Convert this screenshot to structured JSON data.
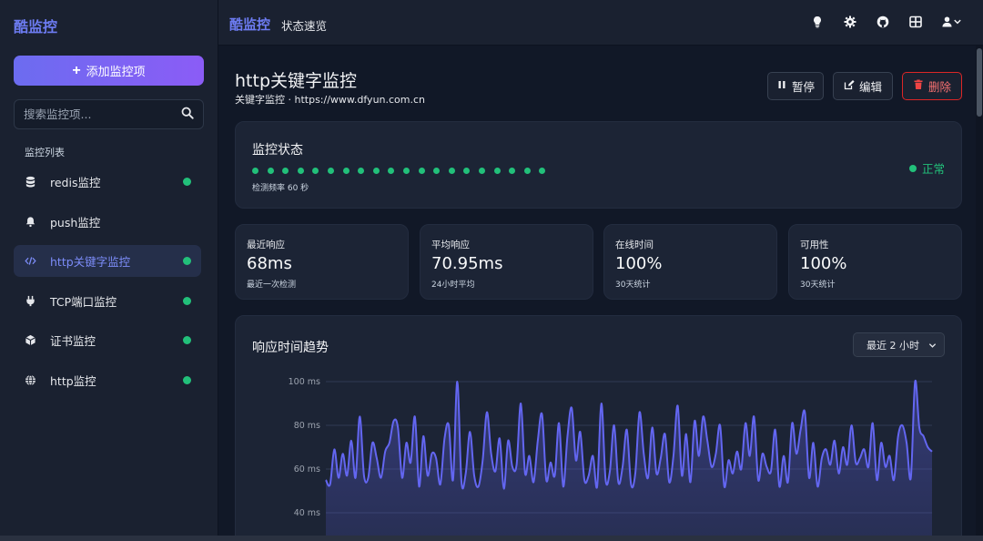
{
  "sidebar": {
    "brand": "酷监控",
    "add_button": "添加监控项",
    "search_placeholder": "搜索监控项...",
    "list_title": "监控列表",
    "items": [
      {
        "label": "redis监控",
        "icon": "database-icon",
        "status": "up"
      },
      {
        "label": "push监控",
        "icon": "bell-icon",
        "status": "none"
      },
      {
        "label": "http关键字监控",
        "icon": "code-icon",
        "status": "up",
        "active": true
      },
      {
        "label": "TCP端口监控",
        "icon": "plug-icon",
        "status": "up"
      },
      {
        "label": "证书监控",
        "icon": "cube-icon",
        "status": "up"
      },
      {
        "label": "http监控",
        "icon": "globe-icon",
        "status": "up"
      }
    ]
  },
  "topbar": {
    "brand": "酷监控",
    "subtitle": "状态速览",
    "icons": [
      "lightbulb-icon",
      "gear-icon",
      "github-icon",
      "grid-icon",
      "user-icon"
    ]
  },
  "monitor": {
    "title": "http关键字监控",
    "subtitle": "关键字监控 · https://www.dfyun.com.cn",
    "pause_label": "暂停",
    "edit_label": "编辑",
    "delete_label": "删除"
  },
  "status_card": {
    "title": "监控状态",
    "heartbeat_count": 20,
    "frequency": "检测频率 60 秒",
    "status_text": "正常"
  },
  "stats": [
    {
      "label": "最近响应",
      "value": "68ms",
      "note": "最近一次检测"
    },
    {
      "label": "平均响应",
      "value": "70.95ms",
      "note": "24小时平均"
    },
    {
      "label": "在线时间",
      "value": "100%",
      "note": "30天统计"
    },
    {
      "label": "可用性",
      "value": "100%",
      "note": "30天统计"
    }
  ],
  "trend": {
    "title": "响应时间趋势",
    "range_label": "最近 2 小时"
  },
  "colors": {
    "accent": "#6d7cf2",
    "success": "#22c07a",
    "danger": "#ef4444",
    "line": "#6366f1"
  },
  "chart_data": {
    "type": "area",
    "y_ticks": [
      "100 ms",
      "80 ms",
      "60 ms",
      "40 ms"
    ],
    "ylim": [
      40,
      100
    ],
    "values": [
      55,
      53,
      69,
      56,
      67,
      57,
      73,
      56,
      84,
      57,
      56,
      72,
      65,
      56,
      68,
      72,
      82,
      79,
      56,
      72,
      63,
      84,
      52,
      75,
      57,
      67,
      65,
      53,
      74,
      80,
      55,
      100,
      54,
      58,
      77,
      57,
      52,
      64,
      86,
      67,
      59,
      74,
      51,
      73,
      61,
      62,
      90,
      58,
      66,
      54,
      73,
      85,
      55,
      63,
      57,
      81,
      52,
      75,
      88,
      64,
      77,
      55,
      57,
      66,
      52,
      90,
      55,
      59,
      80,
      54,
      61,
      78,
      53,
      58,
      86,
      67,
      56,
      79,
      58,
      65,
      76,
      54,
      66,
      89,
      57,
      76,
      54,
      82,
      66,
      84,
      73,
      61,
      67,
      80,
      52,
      64,
      58,
      68,
      60,
      81,
      66,
      84,
      55,
      67,
      61,
      59,
      78,
      52,
      66,
      54,
      81,
      67,
      78,
      86,
      56,
      72,
      52,
      65,
      69,
      62,
      73,
      58,
      70,
      62,
      80,
      63,
      65,
      69,
      61,
      81,
      55,
      72,
      61,
      66,
      55,
      75,
      80,
      72,
      56,
      100,
      79,
      75,
      70,
      68
    ]
  }
}
